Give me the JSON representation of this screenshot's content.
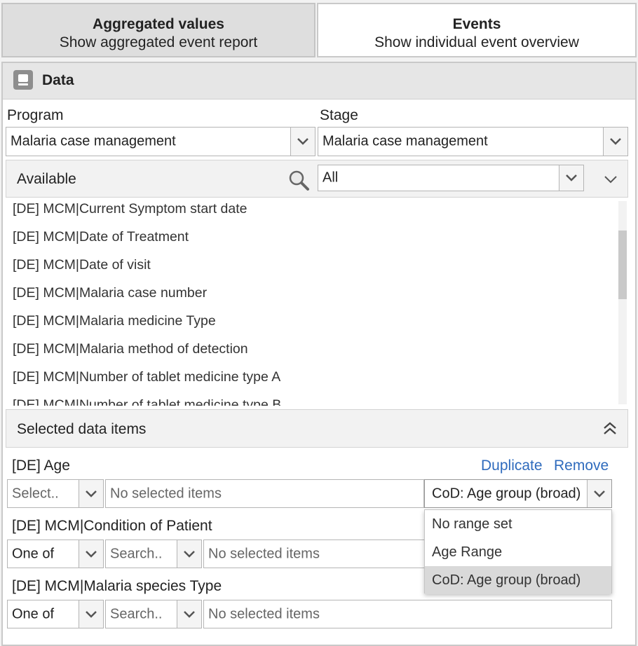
{
  "tabs": [
    {
      "title": "Aggregated values",
      "subtitle": "Show aggregated event report"
    },
    {
      "title": "Events",
      "subtitle": "Show individual event overview"
    }
  ],
  "data_panel": {
    "title": "Data",
    "program_label": "Program",
    "program_value": "Malaria case management",
    "stage_label": "Stage",
    "stage_value": "Malaria case management",
    "available_label": "Available",
    "filter_value": "All",
    "available_items": [
      "[DE] MCM|Current Symptom start date",
      "[DE] MCM|Date of Treatment",
      "[DE] MCM|Date of visit",
      "[DE] MCM|Malaria case number",
      "[DE] MCM|Malaria medicine Type",
      "[DE] MCM|Malaria method of detection",
      "[DE] MCM|Number of tablet medicine type A",
      "[DE] MCM|Number of tablet medicine type B"
    ],
    "scroll_position": 0.15
  },
  "selected": {
    "title": "Selected data items",
    "duplicate_label": "Duplicate",
    "remove_label": "Remove",
    "items": [
      {
        "name": "[DE] Age",
        "operator_placeholder": "Select..",
        "values_placeholder": "No selected items",
        "legend_value": "CoD: Age group (broad)"
      },
      {
        "name": "[DE] MCM|Condition of Patient",
        "operator": "One of",
        "search_placeholder": "Search..",
        "values_placeholder": "No selected items"
      },
      {
        "name": "[DE] MCM|Malaria species Type",
        "operator": "One of",
        "search_placeholder": "Search..",
        "values_placeholder": "No selected items"
      }
    ],
    "legend_options": [
      "No range set",
      "Age Range",
      "CoD: Age group (broad)"
    ],
    "legend_selected_index": 2
  },
  "colors": {
    "link": "#2f6bbd",
    "selected_option": "#d9d9d9"
  }
}
